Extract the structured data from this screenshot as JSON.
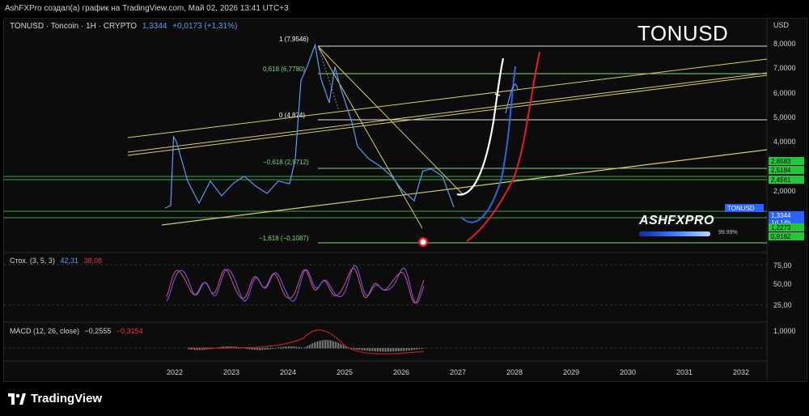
{
  "header": {
    "attribution": "AshFXPro создал(а) график на TradingView.com, Май 02, 2026 13:41 UTC+3"
  },
  "symbol": {
    "name": "TONUSD · Toncoin · 1H · CRYPTO",
    "price": "1,3344",
    "change": "+0,0173 (+1,31%)"
  },
  "title": "TONUSD",
  "currency": "USD",
  "stoch": {
    "label": "Стох. (3, 5, 3)",
    "k": "42,31",
    "d": "38,08"
  },
  "macd": {
    "label": "MACD (12, 26, close)",
    "macd": "−0,2555",
    "signal": "−0,3154"
  },
  "brand": {
    "name": "ASHFXPRO",
    "progress_label": "99.99%",
    "progress": 0.9999
  },
  "footer": {
    "logo": "TradingView"
  },
  "colors": {
    "price": "#5b9cf6",
    "stoch_k": "#7a5cff",
    "stoch_d": "#e0507a",
    "red_curve": "#e0202a",
    "white_curve": "#ffffff",
    "fib": "#7fd97f",
    "trend": "#d6cf6a",
    "tag_green": "#22c73a",
    "tag_blue": "#2962ff"
  },
  "chart_data": {
    "type": "line",
    "x_labels": [
      "2022",
      "2023",
      "2024",
      "2025",
      "2026",
      "2027",
      "2028",
      "2029",
      "2030",
      "2031",
      "2032"
    ],
    "y_labels": [
      "8,0000",
      "7,0000",
      "6,0000",
      "5,0000",
      "4,0000",
      "2,0000",
      "1,0000"
    ],
    "fib_levels": [
      {
        "label": "1 (7,9546)",
        "value": 7.9546
      },
      {
        "label": "0,618 (6,7780)",
        "value": 6.778
      },
      {
        "label": "0 (4,874)",
        "value": 4.874
      },
      {
        "label": "−0,618 (2,9712)",
        "value": 2.9712
      },
      {
        "label": "−1,618 (−0,1087)",
        "value": -0.1087
      }
    ],
    "price_tags": [
      {
        "label": "2,6583",
        "kind": "green"
      },
      {
        "label": "2,5184",
        "kind": "green"
      },
      {
        "label": "2,4561",
        "kind": "green"
      },
      {
        "label": "TONUSD",
        "kind": "blue"
      },
      {
        "label": "1,3344",
        "kind": "blue"
      },
      {
        "label": "1d 14h",
        "kind": "blue"
      },
      {
        "label": "1,2273",
        "kind": "green"
      },
      {
        "label": "0,9162",
        "kind": "green"
      }
    ],
    "price_series": {
      "name": "TONUSD",
      "x": [
        2021.8,
        2021.9,
        2021.95,
        2022.0,
        2022.1,
        2022.2,
        2022.4,
        2022.6,
        2022.8,
        2023.0,
        2023.2,
        2023.4,
        2023.6,
        2023.8,
        2024.0,
        2024.1,
        2024.2,
        2024.3,
        2024.45,
        2024.55,
        2024.7,
        2024.8,
        2024.9,
        2025.0,
        2025.1,
        2025.2,
        2025.4,
        2025.6,
        2025.8,
        2026.0,
        2026.2,
        2026.35,
        2026.5,
        2026.7,
        2026.9
      ],
      "y": [
        1.3,
        1.4,
        4.2,
        4.0,
        3.2,
        2.4,
        1.5,
        2.4,
        1.8,
        2.3,
        2.6,
        2.2,
        1.9,
        2.4,
        2.3,
        3.3,
        6.5,
        7.0,
        7.95,
        6.6,
        5.6,
        7.05,
        6.2,
        5.5,
        4.8,
        3.8,
        3.3,
        3.0,
        2.6,
        2.0,
        1.6,
        2.8,
        2.9,
        2.6,
        1.33
      ]
    },
    "ylim": [
      -0.4,
      8.4
    ],
    "xlim": [
      2021.6,
      2032.3
    ],
    "grid": true
  }
}
